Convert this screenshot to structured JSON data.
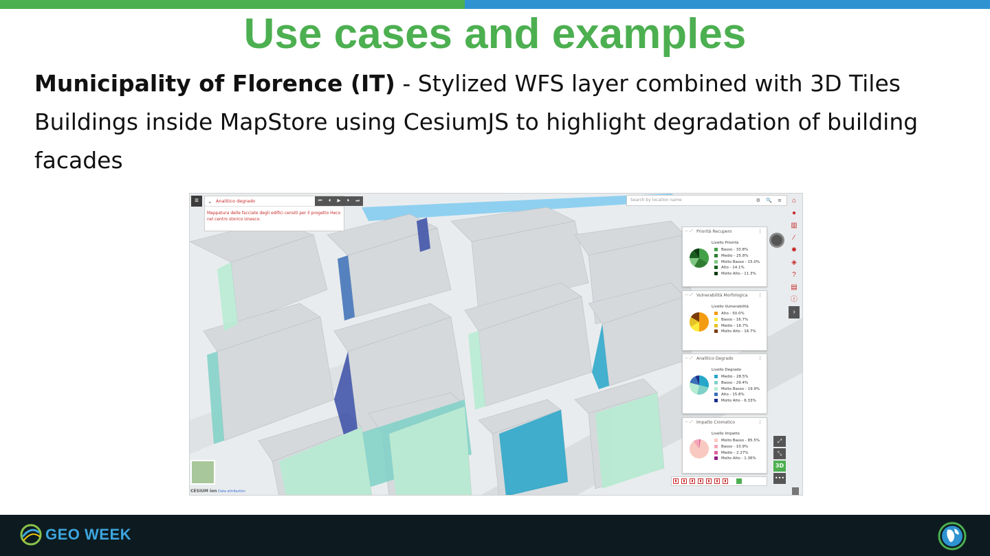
{
  "slide": {
    "title": "Use cases and examples",
    "subtitle_bold": "Municipality of Florence (IT)",
    "subtitle_rest": " - Stylized WFS layer combined with 3D Tiles Buildings inside MapStore using CesiumJS to highlight degradation of building facades",
    "colors": {
      "green": "#4caf50",
      "blue": "#2f93d1",
      "footer": "#0d1b20"
    }
  },
  "mapstore": {
    "layer_title": "Analitico degrado",
    "layer_description": "Mappatura delle facciate degli edifici censiti per il progetto Heco nel centro storico Unesco.",
    "player_buttons": [
      "⏮",
      "⏴",
      "▶",
      "⏵",
      "⏭"
    ],
    "search_placeholder": "Search by location name",
    "toolbar_icons": [
      "home-icon",
      "user-icon",
      "map-icon",
      "ruler-icon",
      "gear-icon",
      "share-icon",
      "help-icon",
      "book-icon",
      "info-icon",
      "expand-icon"
    ],
    "widgets": [
      {
        "title": "Priorità Recupero",
        "legend_title": "Livello Priorità",
        "entries": [
          {
            "label": "Basso - 33.8%",
            "color": "#43a047"
          },
          {
            "label": "Medio - 25.8%",
            "color": "#2e7d32"
          },
          {
            "label": "Molto Basso - 15.0%",
            "color": "#81c784"
          },
          {
            "label": "Alto - 14.1%",
            "color": "#1b5e20"
          },
          {
            "label": "Molto Alto - 11.3%",
            "color": "#0d3b12"
          }
        ]
      },
      {
        "title": "Vulnerabilità Morfologica",
        "legend_title": "Livello Vulnerabilità",
        "entries": [
          {
            "label": "Alto - 50.0%",
            "color": "#f39c12"
          },
          {
            "label": "Basso - 16.7%",
            "color": "#ffeb3b"
          },
          {
            "label": "Medio - 16.7%",
            "color": "#e6c229"
          },
          {
            "label": "Molto Alto - 16.7%",
            "color": "#7a3b0c"
          }
        ]
      },
      {
        "title": "Analitico Degrado",
        "legend_title": "Livello Degrado",
        "entries": [
          {
            "label": "Medio - 28.5%",
            "color": "#26a6c9"
          },
          {
            "label": "Basso - 29.4%",
            "color": "#7fd1c7"
          },
          {
            "label": "Molto Basso - 19.9%",
            "color": "#b6ecd2"
          },
          {
            "label": "Alto - 15.8%",
            "color": "#3b6fb6"
          },
          {
            "label": "Molto Alto - 6.33%",
            "color": "#1d2c8a"
          }
        ]
      },
      {
        "title": "Impatto Cromatico",
        "legend_title": "Livello Impatto",
        "entries": [
          {
            "label": "Molto Basso - 85.5%",
            "color": "#f8c9c1"
          },
          {
            "label": "Basso - 10.9%",
            "color": "#f4a6b8"
          },
          {
            "label": "Medio - 2.27%",
            "color": "#e05f9c"
          },
          {
            "label": "Molto Alto - 1.36%",
            "color": "#8e1a7e"
          }
        ]
      }
    ],
    "right_buttons": [
      "⤢",
      "⤡",
      "3D",
      "•••"
    ],
    "credits": "Data attribution",
    "credits_brand": "CESIUM ion"
  },
  "footer": {
    "brand": "GEO WEEK"
  }
}
